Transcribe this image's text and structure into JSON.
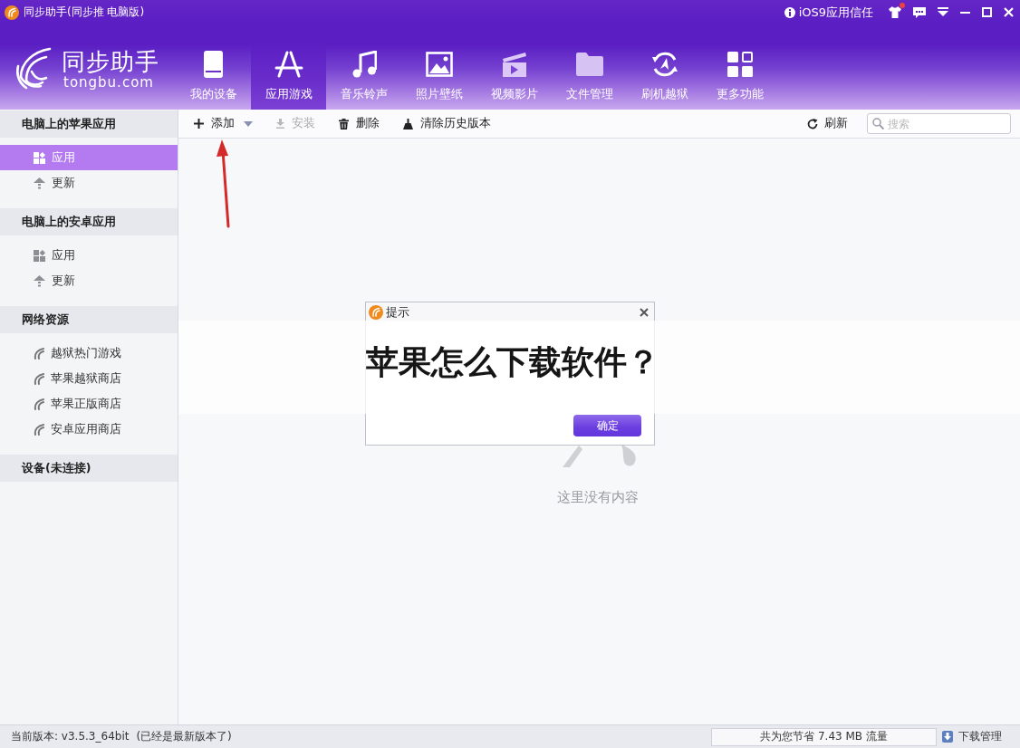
{
  "window": {
    "title": "同步助手(同步推 电脑版)",
    "trust_link": "iOS9应用信任",
    "skin_badge": true
  },
  "brand": {
    "name": "同步助手",
    "domain": "tongbu.com"
  },
  "nav_tabs": [
    {
      "label": "我的设备",
      "kind": "device",
      "selected": false
    },
    {
      "label": "应用游戏",
      "kind": "apps",
      "selected": true
    },
    {
      "label": "音乐铃声",
      "kind": "music",
      "selected": false
    },
    {
      "label": "照片壁纸",
      "kind": "photos",
      "selected": false
    },
    {
      "label": "视频影片",
      "kind": "videos",
      "selected": false
    },
    {
      "label": "文件管理",
      "kind": "files",
      "selected": false
    },
    {
      "label": "刷机越狱",
      "kind": "jailbreak",
      "selected": false
    },
    {
      "label": "更多功能",
      "kind": "more",
      "selected": false
    }
  ],
  "sidebar": {
    "sections": [
      {
        "title": "电脑上的苹果应用",
        "items": [
          {
            "label": "应用",
            "kind": "apps",
            "selected": true
          },
          {
            "label": "更新",
            "kind": "update",
            "selected": false
          }
        ]
      },
      {
        "title": "电脑上的安卓应用",
        "items": [
          {
            "label": "应用",
            "kind": "apps",
            "selected": false
          },
          {
            "label": "更新",
            "kind": "update",
            "selected": false
          }
        ]
      },
      {
        "title": "网络资源",
        "items": [
          {
            "label": "越狱热门游戏",
            "kind": "store",
            "selected": false
          },
          {
            "label": "苹果越狱商店",
            "kind": "store",
            "selected": false
          },
          {
            "label": "苹果正版商店",
            "kind": "store",
            "selected": false
          },
          {
            "label": "安卓应用商店",
            "kind": "store",
            "selected": false
          }
        ]
      },
      {
        "title": "设备(未连接)"
      }
    ]
  },
  "toolbar": {
    "actions": [
      {
        "label": "添加",
        "kind": "add",
        "disabled": false,
        "has_menu": true
      },
      {
        "label": "安装",
        "kind": "install",
        "disabled": true,
        "has_menu": false
      },
      {
        "label": "删除",
        "kind": "delete",
        "disabled": false,
        "has_menu": false
      },
      {
        "label": "清除历史版本",
        "kind": "clear",
        "disabled": false,
        "has_menu": false
      }
    ],
    "refresh": {
      "label": "刷新"
    },
    "search": {
      "placeholder": "搜索"
    }
  },
  "content": {
    "empty_message": "这里没有内容"
  },
  "dialog": {
    "title": "提示",
    "confirm_button": "确定"
  },
  "banner": {
    "headline": "苹果怎么下载软件？"
  },
  "status_bar": {
    "version": "当前版本: v3.5.3_64bit",
    "version_note": "(已经是最新版本了)",
    "savings": "共为您节省 7.43 MB 流量",
    "download_manager": "下载管理"
  }
}
